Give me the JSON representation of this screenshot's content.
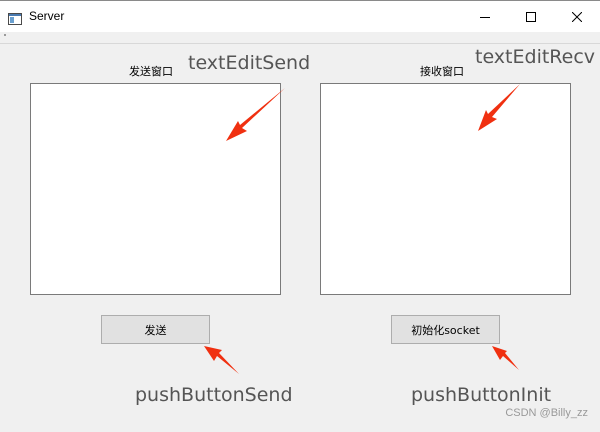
{
  "window": {
    "title": "Server"
  },
  "send_pane": {
    "label": "发送窗口",
    "annotation": "textEditSend"
  },
  "recv_pane": {
    "label": "接收窗口",
    "annotation": "textEditRecv"
  },
  "buttons": {
    "send_label": "发送",
    "send_annotation": "pushButtonSend",
    "init_label": "初始化socket",
    "init_annotation": "pushButtonInit"
  },
  "watermark": "CSDN @Billy_zz",
  "colors": {
    "annotation_arrow": "#f03010",
    "annotation_text": "#555555"
  }
}
